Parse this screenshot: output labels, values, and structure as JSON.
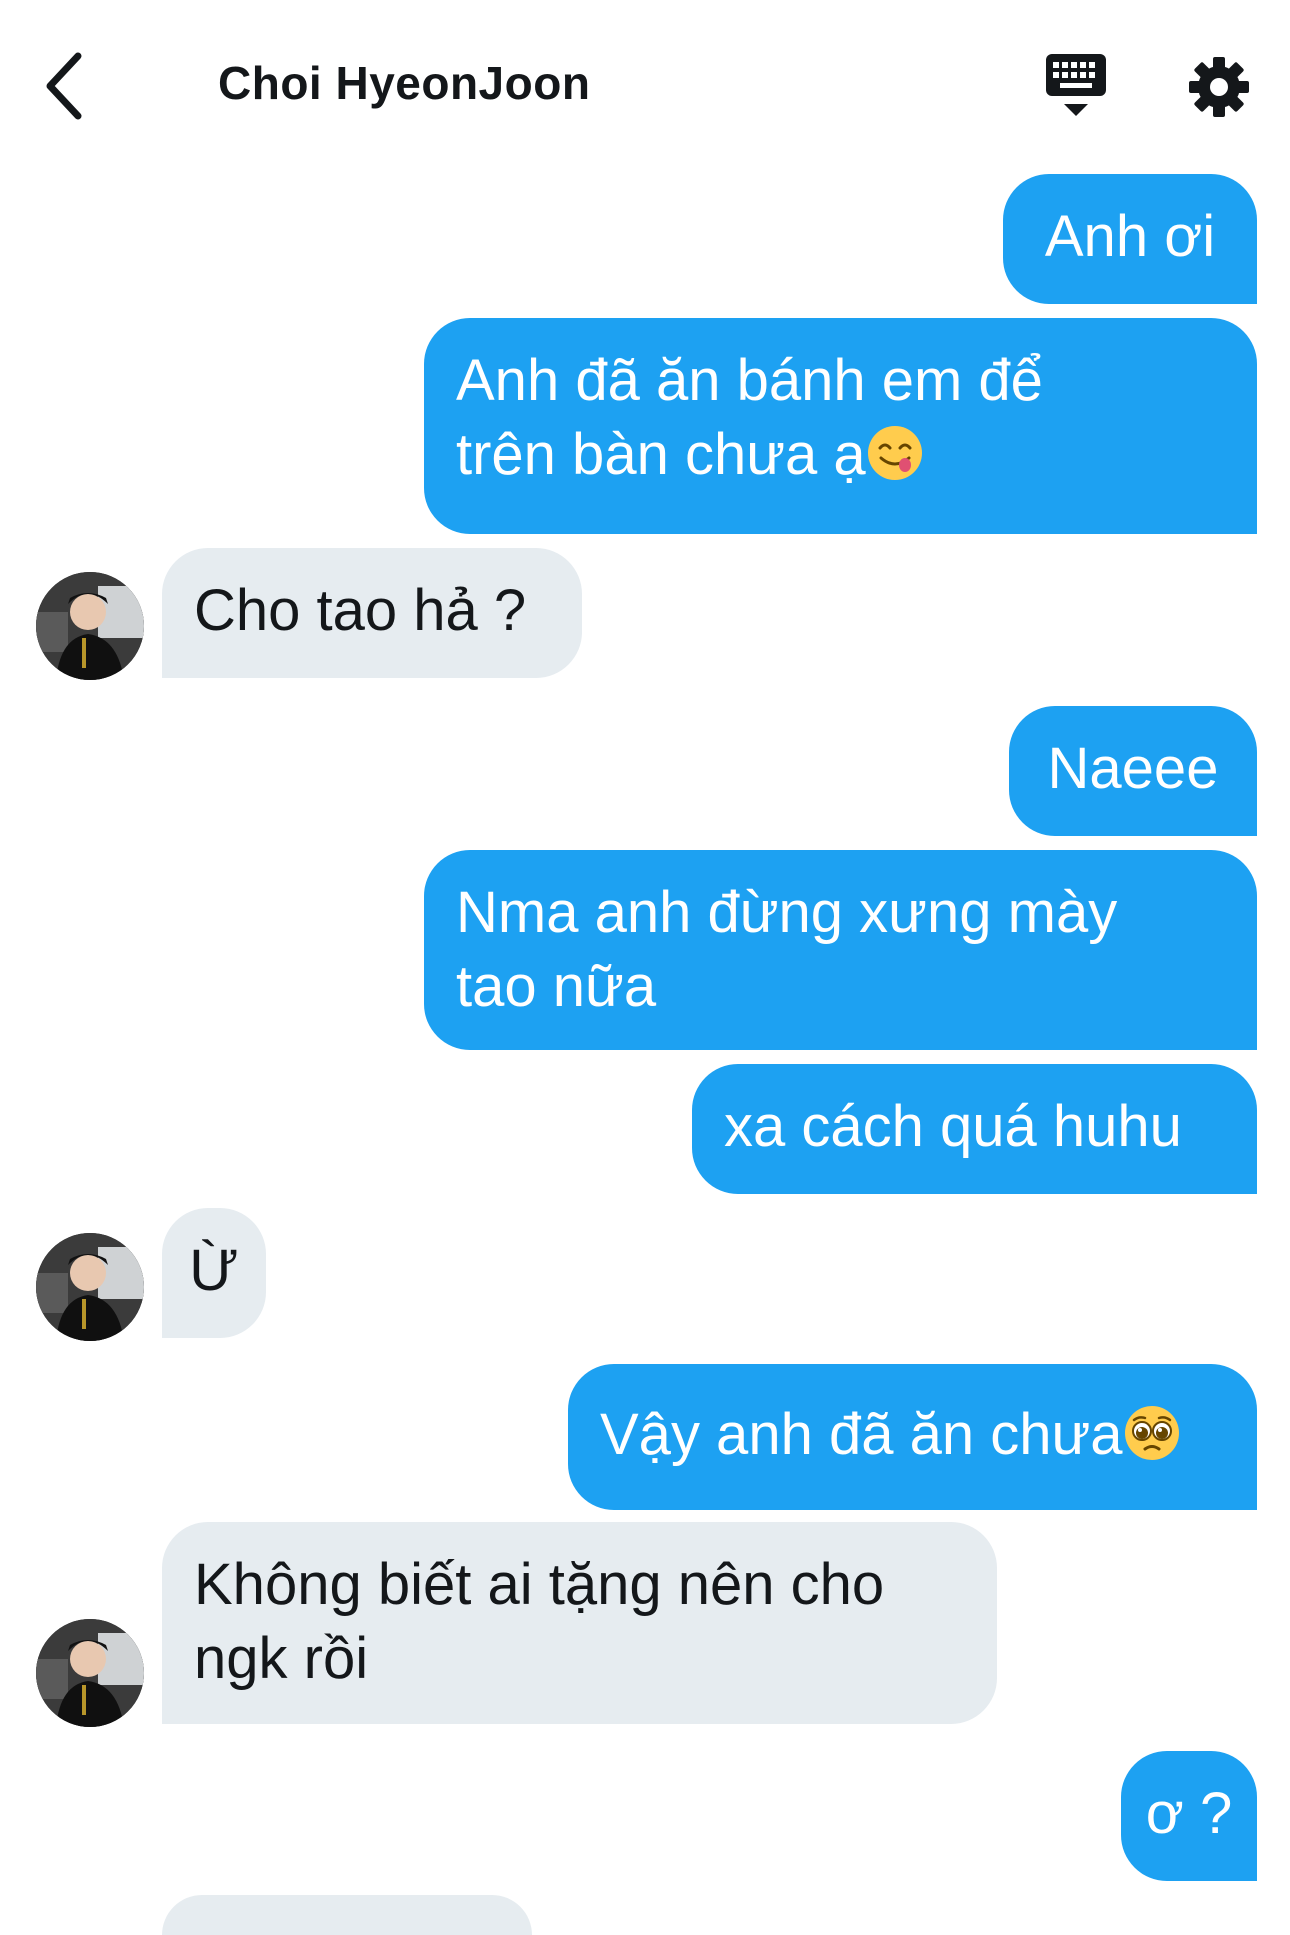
{
  "header": {
    "title": "Choi HyeonJoon",
    "back_icon": "chevron-left-icon",
    "keyboard_icon": "keyboard-icon",
    "settings_icon": "gear-icon"
  },
  "colors": {
    "sent_bubble": "#1da1f2",
    "received_bubble": "#e6ecf0",
    "text_dark": "#14171a"
  },
  "messages": [
    {
      "side": "sent",
      "text": "Anh ơi"
    },
    {
      "side": "sent",
      "line1": "Anh đã ăn bánh em để",
      "line2": "trên bàn chưa ạ",
      "emoji": "face-savoring-food-emoji"
    },
    {
      "side": "received",
      "text": "Cho tao hả ?"
    },
    {
      "side": "sent",
      "text": "Naeee"
    },
    {
      "side": "sent",
      "line1": "Nma anh đừng xưng mày",
      "line2": "tao nữa"
    },
    {
      "side": "sent",
      "text": "xa cách quá huhu"
    },
    {
      "side": "received",
      "text": "Ừ"
    },
    {
      "side": "sent",
      "text": "Vậy anh đã ăn chưa",
      "emoji": "pleading-face-emoji"
    },
    {
      "side": "received",
      "line1": "Không biết ai tặng nên cho",
      "line2": "ngk rồi"
    },
    {
      "side": "sent",
      "text": "ơ ?"
    }
  ]
}
